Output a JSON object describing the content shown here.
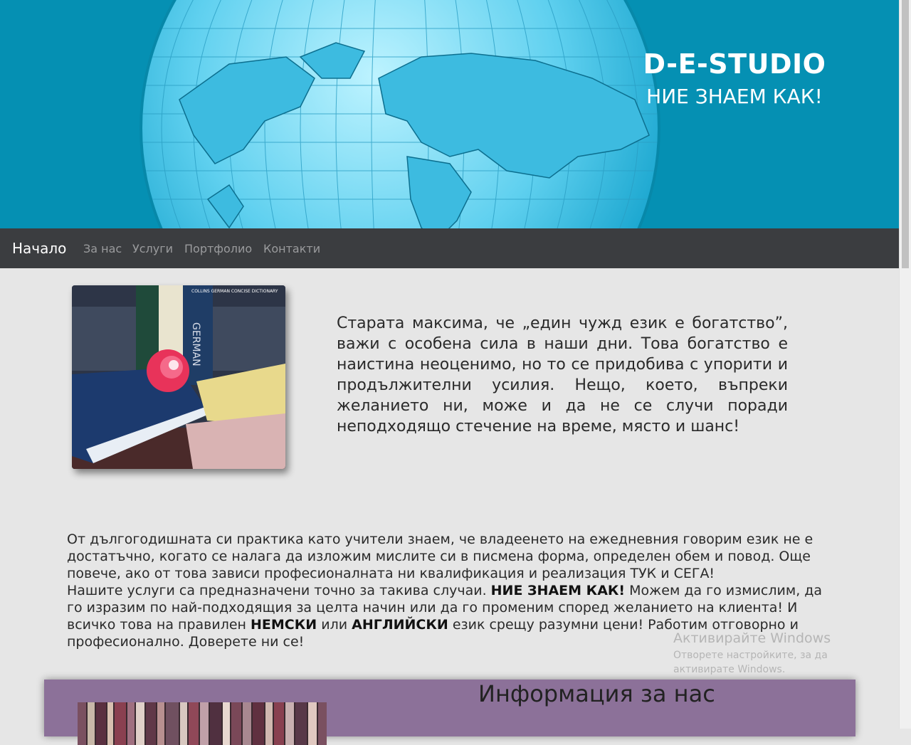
{
  "header": {
    "brand_title": "D-E-STUDIO",
    "slogan": "НИЕ ЗНАЕМ КАК!"
  },
  "nav": {
    "home": "Начало",
    "items": [
      "За нас",
      "Услуги",
      "Портфолио",
      "Контакти"
    ]
  },
  "intro": {
    "text": "Старата максима, че „един чужд език е богатство”, важи с особена сила в наши дни. Това богатство е наистина неоценимо, но то се придобива с упорити и продължителни усилия. Нещо, което, въпреки желанието ни, може и да не се случи поради неподходящо стечение на време, място и шанс!",
    "book_label_dictionary": "GERMAN",
    "book_label_collins": "COLLINS GERMAN CONCISE DICTIONARY"
  },
  "body": {
    "p1": "От дългогодишната си практика като учители знаем, че владеенето на ежедневния говорим език не е достатъчно, когато се налага да изложим мислите си в писмена форма, определен обем и повод. Още повече, ако от това зависи професионалната ни квалификация и реализация ТУК и СЕГА!",
    "p2_a": "Нашите услуги са предназначени точно за такива случаи. ",
    "p2_b": "НИЕ ЗНАЕМ КАК!",
    "p2_c": " Можем да го измислим, да го изразим по най-подходящия за целта начин или да го променим според желанието на клиента! И всичко това на правилен ",
    "p2_d": "НЕМСКИ",
    "p2_e": " или ",
    "p2_f": "АНГЛИЙСКИ",
    "p2_g": " език срещу разумни цени! Работим отговорно и професионално. Доверете ни се!"
  },
  "watermark": {
    "title": "Активирайте Windows",
    "subtitle": "Отворете настройките, за да активирате Windows."
  },
  "info": {
    "title": "Информация за нас"
  },
  "colors": {
    "banner": "#0590b3",
    "nav": "#3b3d40",
    "info_bg": "#8c7199"
  }
}
